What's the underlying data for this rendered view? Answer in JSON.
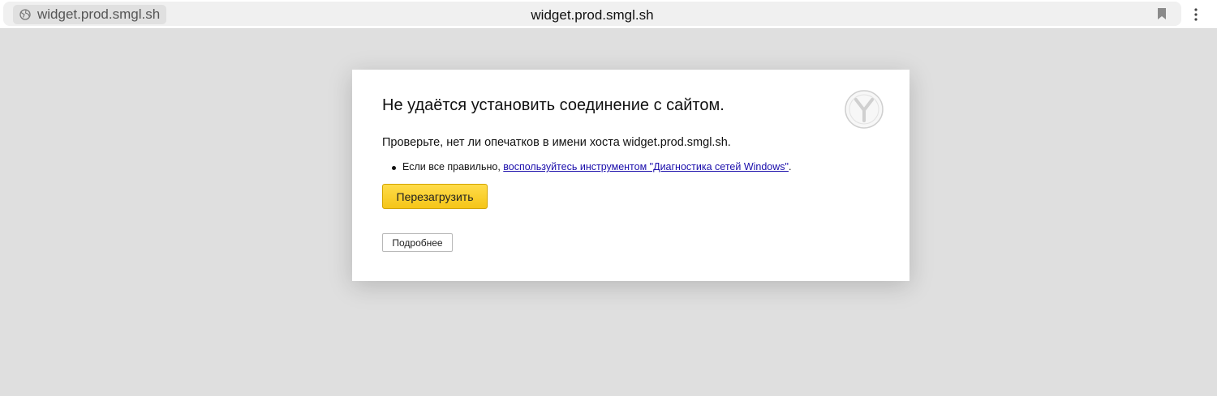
{
  "toolbar": {
    "site_chip": "widget.prod.smgl.sh",
    "url": "widget.prod.smgl.sh"
  },
  "error": {
    "title": "Не удаётся установить соединение с сайтом.",
    "check": "Проверьте, нет ли опечатков в имени хоста widget.prod.smgl.sh.",
    "bullet_prefix": "Если все правильно, ",
    "bullet_link": "воспользуйтесь инструментом \"Диагностика сетей Windows\"",
    "bullet_suffix": ".",
    "reload_label": "Перезагрузить",
    "details_label": "Подробнее"
  },
  "colors": {
    "page_background": "#dfdfdf",
    "reload_button": "#fdd835",
    "link": "#1a0dab"
  },
  "icons": {
    "site_info": "globe-icon",
    "bookmark": "bookmark-icon",
    "menu": "kebab-menu-icon",
    "brand": "yandex-browser-logo"
  }
}
